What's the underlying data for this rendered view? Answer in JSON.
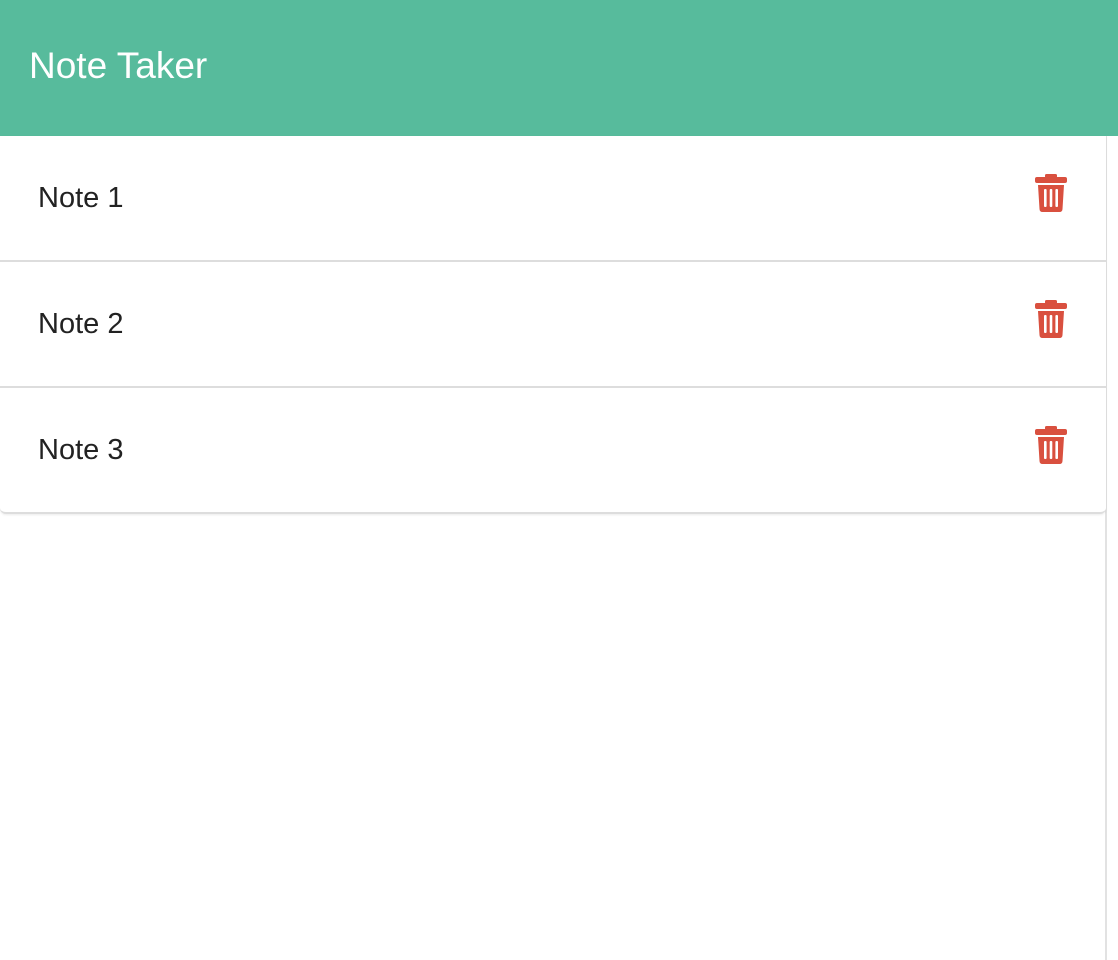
{
  "navbar": {
    "title": "Note Taker",
    "background_color": "#57bb9c"
  },
  "notes": [
    {
      "title": "Note 1",
      "delete_icon": "trash-icon"
    },
    {
      "title": "Note 2",
      "delete_icon": "trash-icon"
    },
    {
      "title": "Note 3",
      "delete_icon": "trash-icon"
    }
  ],
  "colors": {
    "accent": "#57bb9c",
    "delete": "#d9503f",
    "text": "#222222",
    "border": "#dddddd"
  }
}
